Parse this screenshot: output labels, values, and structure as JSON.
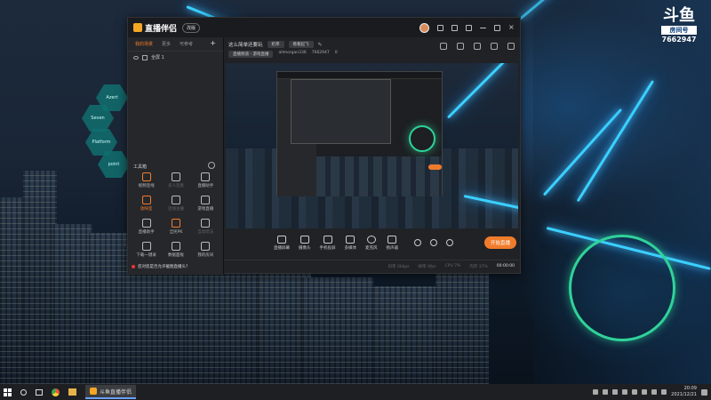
{
  "desktop": {
    "brand": {
      "logo": "斗鱼",
      "tag": "房间号",
      "number": "7662947"
    },
    "hex_labels": [
      "Azert",
      "Seven",
      "Platform",
      "point"
    ]
  },
  "app": {
    "name": "直播伴侣",
    "version_badge": "改版",
    "sidebar": {
      "tabs": [
        "我的场景",
        "更多",
        "可参考"
      ],
      "add": "+",
      "scene": "全屏 1",
      "tools_header": "工具箱",
      "tools": [
        {
          "label": "视频连线",
          "dim": false
        },
        {
          "label": "多人连麦",
          "dim": true
        },
        {
          "label": "直播助手",
          "dim": false
        },
        {
          "label": "放映室",
          "dim": false
        },
        {
          "label": "连线主播",
          "dim": true
        },
        {
          "label": "游戏直播",
          "dim": false
        },
        {
          "label": "直播助手",
          "dim": false
        },
        {
          "label": "全民PK",
          "dim": false
        },
        {
          "label": "互动玩法",
          "dim": true
        },
        {
          "label": "下载一键录",
          "dim": false
        },
        {
          "label": "数据面板",
          "dim": false
        },
        {
          "label": "我的房间",
          "dim": false
        }
      ],
      "notice": "您对您是否允许截图直播头?"
    },
    "room": {
      "title": "这么简单还要玩",
      "tag1": "奶茶",
      "tag2": "看看起飞",
      "category": "直播频道 - 游戏直播",
      "streamer": "allmorgan336",
      "room_id": "7662947",
      "fans": "0"
    },
    "bottom_tools": [
      "直播屏幕",
      "摄像头",
      "手机投屏",
      "多媒体",
      "麦克风",
      "扬声器"
    ],
    "start_live": "开始直播",
    "status": {
      "bitrate": "码率 0kbps",
      "fps": "帧率 0fps",
      "cpu": "CPU 7%",
      "mem": "内存 37%",
      "time": "00:00:00"
    }
  },
  "taskbar": {
    "task_label": "斗鱼直播伴侣",
    "time": "20:09",
    "date": "2021/12/21"
  }
}
